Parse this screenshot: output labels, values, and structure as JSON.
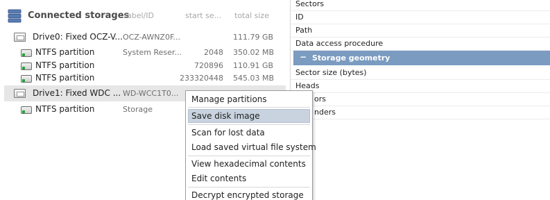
{
  "tree_header": {
    "title": "Connected storages",
    "col_label": "label/ID",
    "col_start": "start se...",
    "col_size": "total size"
  },
  "drives": [
    {
      "name": "Drive0: Fixed OCZ-V...",
      "label": "OCZ-AWNZ0F...",
      "start": "",
      "size": "111.79 GB",
      "partitions": [
        {
          "name": "NTFS partition",
          "label": "System Reser...",
          "start": "2048",
          "size": "350.02 MB"
        },
        {
          "name": "NTFS partition",
          "label": "",
          "start": "720896",
          "size": "110.91 GB"
        },
        {
          "name": "NTFS partition",
          "label": "",
          "start": "233320448",
          "size": "545.03 MB"
        }
      ]
    },
    {
      "name": "Drive1: Fixed WDC ...",
      "label": "WD-WCC1T0...",
      "start": "",
      "size": "",
      "partitions": [
        {
          "name": "NTFS partition",
          "label": "Storage",
          "start": "",
          "size": ""
        }
      ]
    }
  ],
  "properties": {
    "rows_top": [
      "Sectors",
      "ID",
      "Path",
      "Data access procedure"
    ],
    "section_title": "Storage geometry",
    "section_toggle": "−",
    "rows_geometry": [
      "Sector size (bytes)",
      "Heads",
      "ors",
      "nders"
    ]
  },
  "context_menu": {
    "items": [
      "Manage partitions",
      "Save disk image",
      "Scan for lost data",
      "Load saved virtual file system",
      "View hexadecimal contents",
      "Edit contents",
      "Decrypt encrypted storage"
    ],
    "highlighted": "Save disk image"
  },
  "colors": {
    "section_header": "#7b9bc0",
    "selection": "#e6e6e6",
    "menu_highlight": "#c8d3df",
    "partition_led": "#23a23a"
  }
}
